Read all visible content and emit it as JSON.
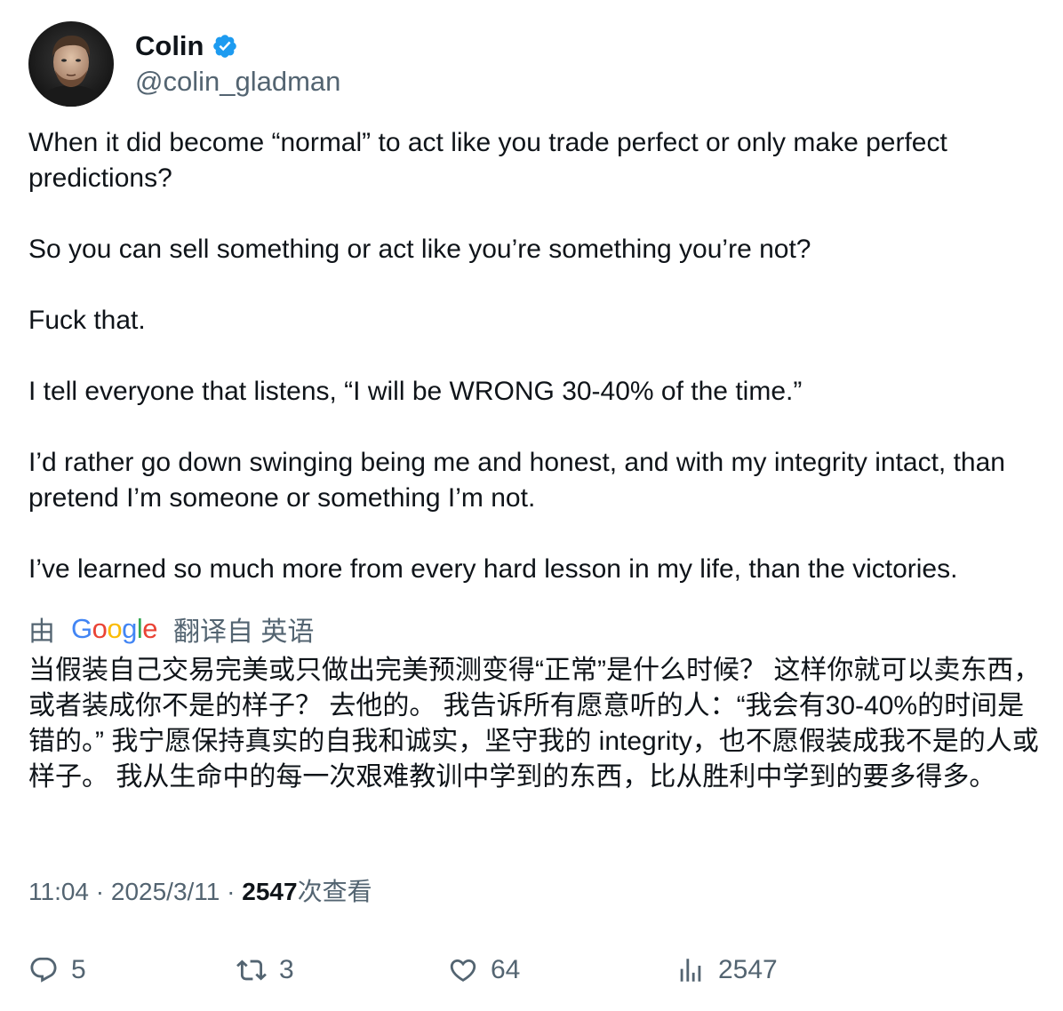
{
  "author": {
    "display_name": "Colin",
    "handle": "@colin_gladman",
    "verified": true,
    "verified_color": "#1d9bf0"
  },
  "tweet": {
    "paragraphs": [
      "When it did become “normal” to act like you trade perfect or only make perfect predictions?",
      "So you can sell something or act like you’re something you’re not?",
      "Fuck that.",
      "I tell everyone that listens, “I will be WRONG 30-40% of the time.”",
      "I’d rather go down swinging being me and honest, and with my integrity intact, than pretend I’m someone or something I’m not.",
      "I’ve learned so much more from every hard lesson in my life, than the victories."
    ]
  },
  "translation": {
    "by_label": "由",
    "provider": "Google",
    "from_label": "翻译自 英语",
    "text": "当假装自己交易完美或只做出完美预测变得“正常”是什么时候？ 这样你就可以卖东西，或者装成你不是的样子？ 去他的。 我告诉所有愿意听的人：“我会有30-40%的时间是错的。” 我宁愿保持真实的自我和诚实，坚守我的 integrity，也不愿假装成我不是的人或样子。 我从生命中的每一次艰难教训中学到的东西，比从胜利中学到的要多得多。"
  },
  "meta": {
    "time": "11:04",
    "separator": "·",
    "date": "2025/3/11",
    "views": "2547",
    "views_label": "次查看"
  },
  "actions": {
    "replies": "5",
    "retweets": "3",
    "likes": "64",
    "views": "2547"
  },
  "colors": {
    "text": "#0f1419",
    "secondary": "#536471",
    "google_blue": "#4285F4",
    "google_red": "#EA4335",
    "google_yellow": "#FBBC05",
    "google_green": "#34A853"
  },
  "icons": {
    "reply": "speech-bubble-icon",
    "retweet": "retweet-arrows-icon",
    "like": "heart-icon",
    "views": "bar-chart-icon",
    "verified": "verified-badge-icon"
  }
}
